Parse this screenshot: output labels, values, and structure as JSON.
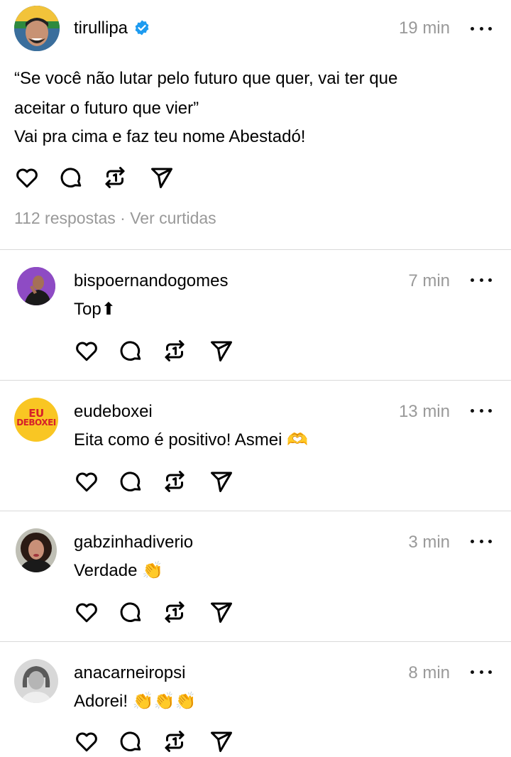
{
  "main_post": {
    "username": "tirullipa",
    "time": "19 min",
    "lines": [
      "“Se você não lutar pelo futuro que quer, vai ter que",
      "aceitar o futuro que vier”",
      "Vai pra cima e faz teu nome Abestadó!"
    ],
    "stats": "112 respostas · Ver curtidas"
  },
  "replies": [
    {
      "username": "bispoernandogomes",
      "time": "7 min",
      "text": "Top⬆"
    },
    {
      "username": "eudeboxei",
      "time": "13 min",
      "text": "Eita como é positivo! Asmei 🫶"
    },
    {
      "username": "gabzinhadiverio",
      "time": "3 min",
      "text": "Verdade 👏"
    },
    {
      "username": "anacarneiropsi",
      "time": "8 min",
      "text": "Adorei! 👏👏👏"
    }
  ],
  "icons": {
    "like": "heart-icon",
    "reply": "comment-icon",
    "repost": "repost-icon",
    "share": "send-icon",
    "more": "more-options-icon",
    "verified": "verified-badge-icon"
  },
  "logo_text": [
    "EU",
    "DEBOXEI"
  ],
  "colors": {
    "verified": "#1d9bf0",
    "muted": "#999999",
    "divider": "#d9d9d9",
    "eudeboxei_bg": "#f9c623",
    "eudeboxei_fg": "#d6202a"
  }
}
